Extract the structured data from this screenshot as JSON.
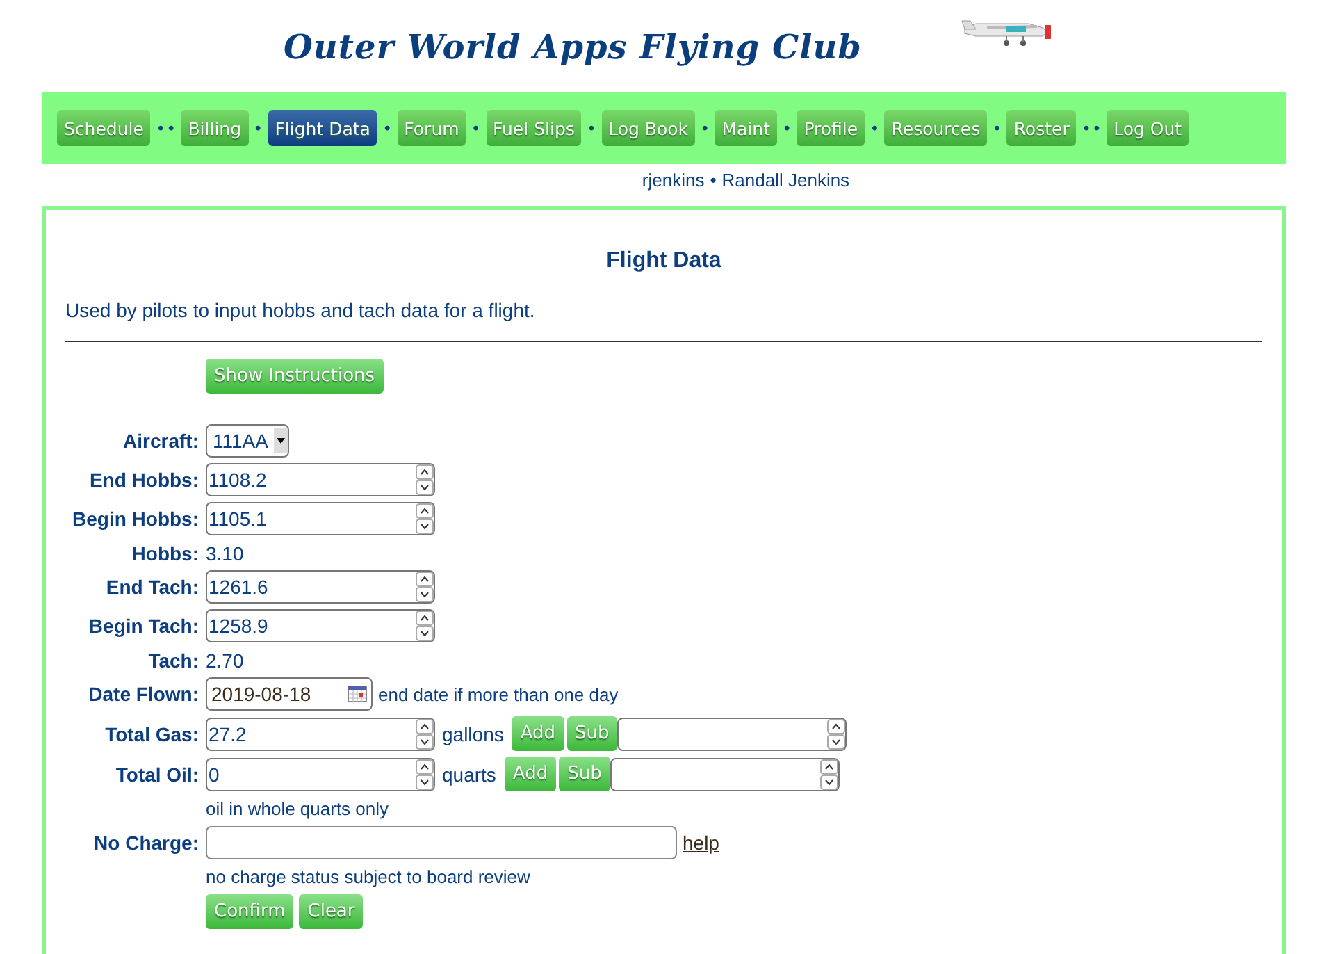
{
  "header": {
    "title": "Outer World Apps Flying Club"
  },
  "nav": [
    {
      "label": "Schedule",
      "selected": false,
      "separator": "• •"
    },
    {
      "label": "Billing",
      "selected": false,
      "separator": "•"
    },
    {
      "label": "Flight Data",
      "selected": true,
      "separator": "•"
    },
    {
      "label": "Forum",
      "selected": false,
      "separator": "•"
    },
    {
      "label": "Fuel Slips",
      "selected": false,
      "separator": "•"
    },
    {
      "label": "Log Book",
      "selected": false,
      "separator": "•"
    },
    {
      "label": "Maint",
      "selected": false,
      "separator": "•"
    },
    {
      "label": "Profile",
      "selected": false,
      "separator": "•"
    },
    {
      "label": "Resources",
      "selected": false,
      "separator": "•"
    },
    {
      "label": "Roster",
      "selected": false,
      "separator": "• •"
    },
    {
      "label": "Log Out",
      "selected": false
    }
  ],
  "user": {
    "username": "rjenkins",
    "separator": "•",
    "full_name": "Randall Jenkins"
  },
  "panel": {
    "title": "Flight Data",
    "description": "Used by pilots to input hobbs and tach data for a flight.",
    "instructions_button": "Show Instructions",
    "rows": [
      {
        "kind": "select",
        "label": "Aircraft:",
        "value": "111AA"
      },
      {
        "kind": "number",
        "label": "End Hobbs:",
        "value": "1108.2"
      },
      {
        "kind": "number",
        "label": "Begin Hobbs:",
        "value": "1105.1"
      },
      {
        "kind": "readout",
        "label": "Hobbs:",
        "value": "3.10"
      },
      {
        "kind": "number",
        "label": "End Tach:",
        "value": "1261.6"
      },
      {
        "kind": "number",
        "label": "Begin Tach:",
        "value": "1258.9"
      },
      {
        "kind": "readout",
        "label": "Tach:",
        "value": "2.70"
      },
      {
        "kind": "date",
        "label": "Date Flown:",
        "value": "2019-08-18",
        "hint": "end date if more than one day"
      },
      {
        "kind": "amount",
        "label": "Total Gas:",
        "value": "27.2",
        "unit": "gallons",
        "add": "Add",
        "sub": "Sub"
      },
      {
        "kind": "amount",
        "label": "Total Oil:",
        "value": "0",
        "unit": "quarts",
        "add": "Add",
        "sub": "Sub"
      },
      {
        "kind": "note",
        "text": "oil in whole quarts only"
      },
      {
        "kind": "text",
        "label": "No Charge:",
        "link": "help"
      },
      {
        "kind": "note",
        "text": "no charge status subject to board review"
      }
    ],
    "buttons": [
      "Confirm",
      "Clear"
    ]
  }
}
